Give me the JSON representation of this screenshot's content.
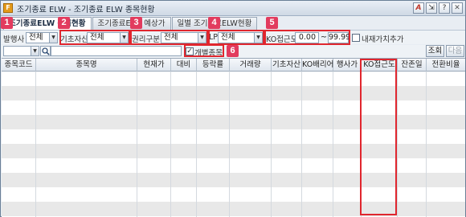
{
  "window": {
    "app_icon": "app-icon",
    "title": "조기종료 ELW - 조기종료 ELW 종목현황",
    "buttons": [
      "A",
      "⇲",
      "?",
      "✕"
    ]
  },
  "tabs": [
    {
      "label": "조기종료ELW 종목현황",
      "active": true
    },
    {
      "label": "조기종료ELW 예상가",
      "active": false
    },
    {
      "label": "일별 조기종료ELW현황",
      "active": false
    }
  ],
  "filters": {
    "issuer_label": "발행사",
    "issuer_value": "전체",
    "underlying_label": "기초자산",
    "underlying_value": "전체",
    "right_label": "권리구분",
    "right_value": "전체",
    "lp_label": "LP",
    "lp_value": "전체",
    "ko_label": "KO접근도",
    "ko_min": "0.00",
    "ko_tilde": "~",
    "ko_max": "99.99",
    "intrinsic_label": "내재가치추가",
    "individual_label": "개별종목",
    "individual_checked": "✓",
    "search_button": "조회",
    "next_button": "다음"
  },
  "callouts": [
    "1",
    "2",
    "3",
    "4",
    "5",
    "6"
  ],
  "grid": {
    "columns": [
      "종목코드",
      "종목명",
      "현재가",
      "대비",
      "등락률",
      "거래량",
      "기초자산",
      "KO배리어",
      "행사가",
      "KO접근도",
      "잔존일",
      "전환비율"
    ]
  }
}
